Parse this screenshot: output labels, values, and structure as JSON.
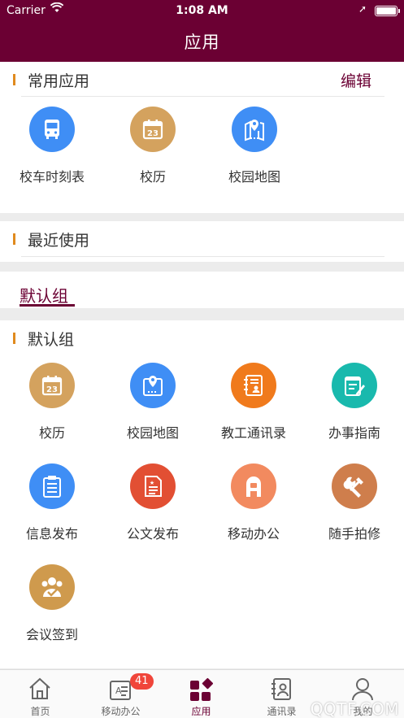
{
  "status_bar": {
    "carrier": "Carrier",
    "time": "1:08 AM"
  },
  "nav": {
    "title": "应用"
  },
  "common": {
    "title": "常用应用",
    "edit_label": "编辑",
    "apps": [
      {
        "name": "校车时刻表",
        "icon": "bus-icon",
        "color": "#3f8ef5"
      },
      {
        "name": "校历",
        "icon": "calendar-icon",
        "color": "#d4a25e"
      },
      {
        "name": "校园地图",
        "icon": "map-pin-icon",
        "color": "#3f8ef5"
      }
    ]
  },
  "recent": {
    "title": "最近使用"
  },
  "group_tab": {
    "label": "默认组"
  },
  "default_group": {
    "title": "默认组",
    "apps": [
      {
        "name": "校历",
        "icon": "calendar-icon",
        "color": "#d4a25e"
      },
      {
        "name": "校园地图",
        "icon": "map-pin-icon",
        "color": "#3f8ef5"
      },
      {
        "name": "教工通讯录",
        "icon": "contacts-book-icon",
        "color": "#f07a1c"
      },
      {
        "name": "办事指南",
        "icon": "guide-edit-icon",
        "color": "#19b9ad"
      },
      {
        "name": "信息发布",
        "icon": "clipboard-icon",
        "color": "#3f8ef5"
      },
      {
        "name": "公文发布",
        "icon": "document-icon",
        "color": "#e24f33"
      },
      {
        "name": "移动办公",
        "icon": "mobile-office-icon",
        "color": "#f28a5f"
      },
      {
        "name": "随手拍修",
        "icon": "repair-tools-icon",
        "color": "#cf7e4c"
      },
      {
        "name": "会议签到",
        "icon": "meeting-checkin-icon",
        "color": "#cf9a4d"
      }
    ]
  },
  "tabbar": {
    "items": [
      {
        "label": "首页",
        "icon": "home-icon"
      },
      {
        "label": "移动办公",
        "icon": "office-card-icon",
        "badge": "41"
      },
      {
        "label": "应用",
        "icon": "apps-grid-icon",
        "active": true
      },
      {
        "label": "通讯录",
        "icon": "address-book-icon"
      },
      {
        "label": "我的",
        "icon": "person-icon"
      }
    ]
  },
  "watermark": "QQTF.COM"
}
